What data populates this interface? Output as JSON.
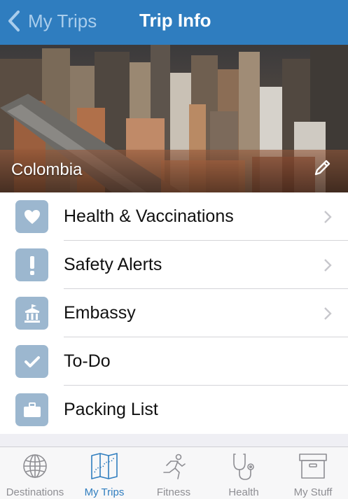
{
  "nav": {
    "back_label": "My Trips",
    "title": "Trip Info"
  },
  "hero": {
    "country": "Colombia"
  },
  "items": [
    {
      "label": "Health & Vaccinations",
      "icon": "heart-icon",
      "chevron": true
    },
    {
      "label": "Safety Alerts",
      "icon": "exclamation-icon",
      "chevron": true
    },
    {
      "label": "Embassy",
      "icon": "building-icon",
      "chevron": true
    },
    {
      "label": "To-Do",
      "icon": "checkmark-icon",
      "chevron": false
    },
    {
      "label": "Packing List",
      "icon": "suitcase-icon",
      "chevron": false
    }
  ],
  "tabs": [
    {
      "label": "Destinations",
      "icon": "globe-icon",
      "active": false
    },
    {
      "label": "My Trips",
      "icon": "map-icon",
      "active": true
    },
    {
      "label": "Fitness",
      "icon": "runner-icon",
      "active": false
    },
    {
      "label": "Health",
      "icon": "stethoscope-icon",
      "active": false
    },
    {
      "label": "My Stuff",
      "icon": "box-icon",
      "active": false
    }
  ],
  "colors": {
    "nav": "#2f7dbf",
    "icon_tile": "#9cb7cf",
    "active_tab": "#2f7dbf",
    "inactive_tab": "#8e8e93"
  }
}
